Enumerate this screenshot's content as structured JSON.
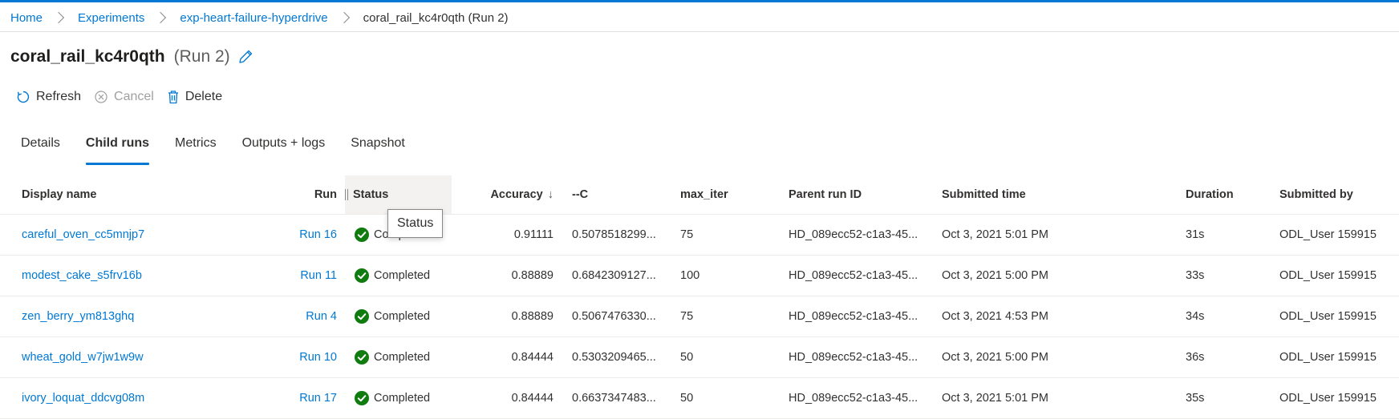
{
  "breadcrumb": {
    "items": [
      "Home",
      "Experiments",
      "exp-heart-failure-hyperdrive"
    ],
    "current": "coral_rail_kc4r0qth (Run 2)"
  },
  "title": {
    "main": "coral_rail_kc4r0qth",
    "sub": "(Run 2)"
  },
  "toolbar": {
    "refresh": "Refresh",
    "cancel": "Cancel",
    "delete": "Delete"
  },
  "tabs": [
    "Details",
    "Child runs",
    "Metrics",
    "Outputs + logs",
    "Snapshot"
  ],
  "active_tab": "Child runs",
  "table": {
    "headers": {
      "display_name": "Display name",
      "run": "Run",
      "status": "Status",
      "accuracy": "Accuracy",
      "sort_arrow": "↓",
      "c": "--C",
      "max_iter": "max_iter",
      "parent": "Parent run ID",
      "submitted_time": "Submitted time",
      "duration": "Duration",
      "submitted_by": "Submitted by"
    },
    "rows": [
      {
        "name": "careful_oven_cc5mnjp7",
        "run": "Run 16",
        "status": "Completed",
        "accuracy": "0.91111",
        "c": "0.5078518299...",
        "max_iter": "75",
        "parent": "HD_089ecc52-c1a3-45...",
        "time": "Oct 3, 2021 5:01 PM",
        "duration": "31s",
        "by": "ODL_User 159915"
      },
      {
        "name": "modest_cake_s5frv16b",
        "run": "Run 11",
        "status": "Completed",
        "accuracy": "0.88889",
        "c": "0.6842309127...",
        "max_iter": "100",
        "parent": "HD_089ecc52-c1a3-45...",
        "time": "Oct 3, 2021 5:00 PM",
        "duration": "33s",
        "by": "ODL_User 159915"
      },
      {
        "name": "zen_berry_ym813ghq",
        "run": "Run 4",
        "status": "Completed",
        "accuracy": "0.88889",
        "c": "0.5067476330...",
        "max_iter": "75",
        "parent": "HD_089ecc52-c1a3-45...",
        "time": "Oct 3, 2021 4:53 PM",
        "duration": "34s",
        "by": "ODL_User 159915"
      },
      {
        "name": "wheat_gold_w7jw1w9w",
        "run": "Run 10",
        "status": "Completed",
        "accuracy": "0.84444",
        "c": "0.5303209465...",
        "max_iter": "50",
        "parent": "HD_089ecc52-c1a3-45...",
        "time": "Oct 3, 2021 5:00 PM",
        "duration": "36s",
        "by": "ODL_User 159915"
      },
      {
        "name": "ivory_loquat_ddcvg08m",
        "run": "Run 17",
        "status": "Completed",
        "accuracy": "0.84444",
        "c": "0.6637347483...",
        "max_iter": "50",
        "parent": "HD_089ecc52-c1a3-45...",
        "time": "Oct 3, 2021 5:01 PM",
        "duration": "35s",
        "by": "ODL_User 159915"
      }
    ]
  },
  "tooltip": "Status",
  "colors": {
    "accent": "#0078d4",
    "success": "#107c10"
  }
}
